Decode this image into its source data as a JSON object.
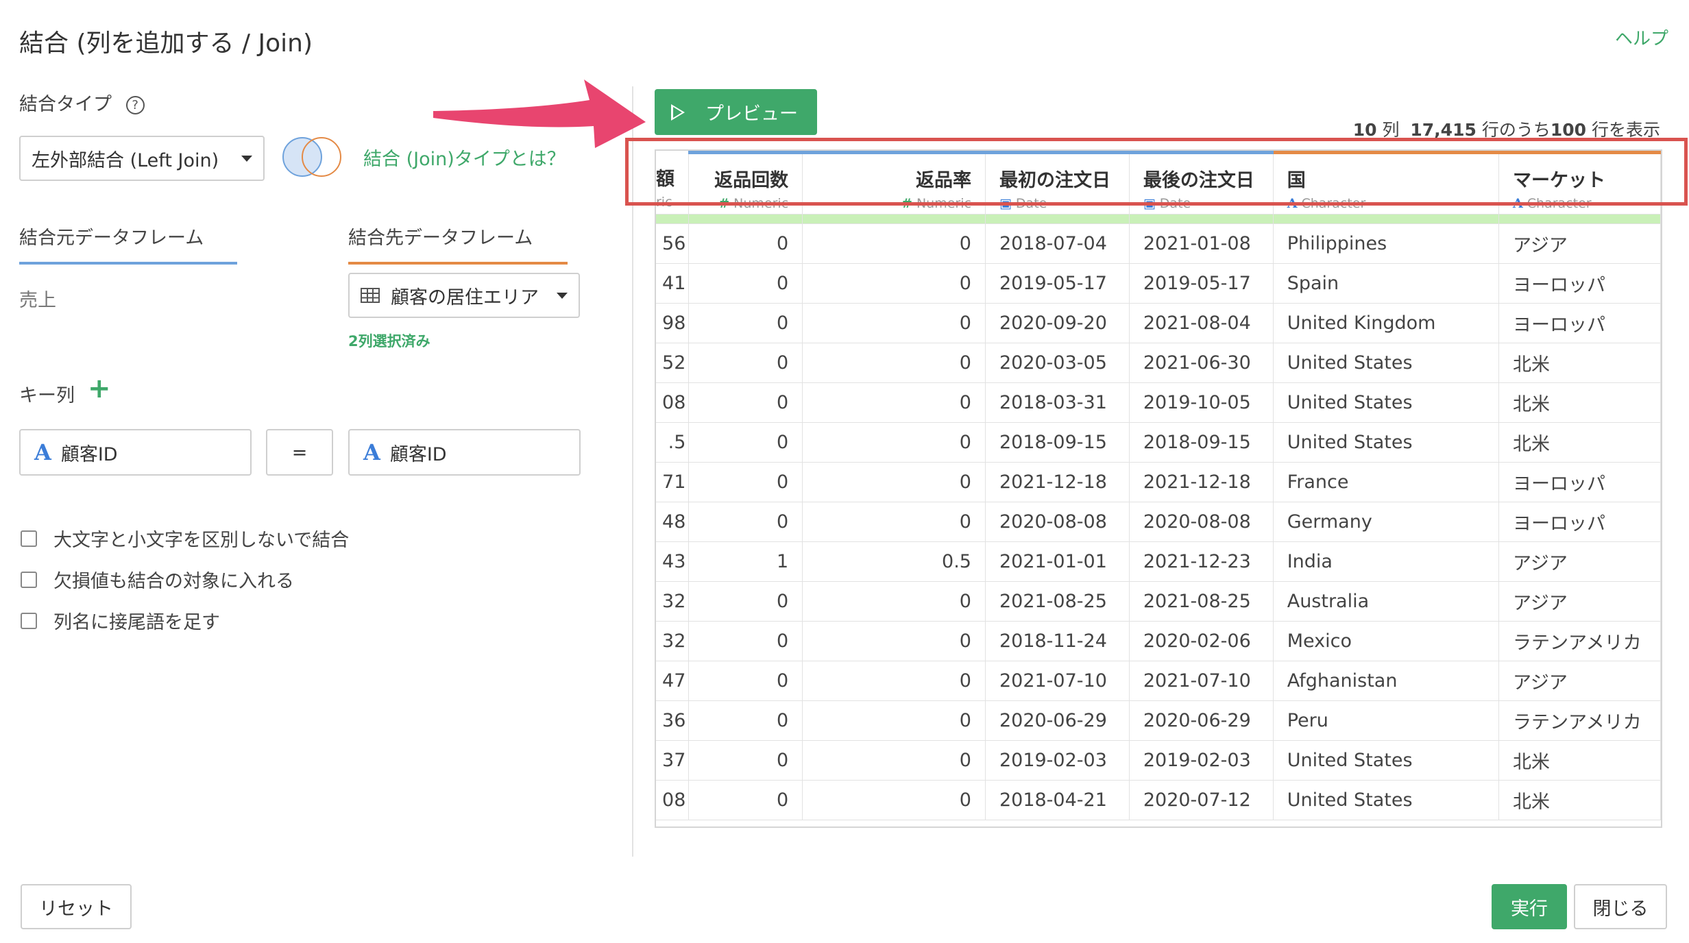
{
  "dialog": {
    "title": "結合 (列を追加する / Join)",
    "help_label": "ヘルプ"
  },
  "join_type": {
    "label": "結合タイプ",
    "help_icon": "question-circle-icon",
    "selected": "左外部結合 (Left Join)",
    "about_link": "結合 (Join)タイプとは？"
  },
  "source_tabs": {
    "left_label": "結合元データフレーム",
    "right_label": "結合先データフレーム",
    "left_value": "売上",
    "right_value": "顧客の居住エリア",
    "right_note": "2列選択済み"
  },
  "key_columns": {
    "label": "キー列",
    "add_icon": "plus-icon",
    "left_type": "A",
    "left_name": "顧客ID",
    "operator": "=",
    "right_type": "A",
    "right_name": "顧客ID"
  },
  "options": [
    {
      "label": "大文字と小文字を区別しないで結合",
      "checked": false
    },
    {
      "label": "欠損値も結合の対象に入れる",
      "checked": false
    },
    {
      "label": "列名に接尾語を足す",
      "checked": false
    }
  ],
  "preview": {
    "button_label": "プレビュー",
    "summary_cols": "10",
    "summary_cols_unit": "列",
    "summary_total": "17,415",
    "summary_mid": "行のうち",
    "summary_shown": "100",
    "summary_end": "行を表示"
  },
  "table": {
    "columns": [
      {
        "name": "額",
        "type": "ric",
        "type_icon": ""
      },
      {
        "name": "返品回数",
        "type": "Numeric",
        "type_icon": "#"
      },
      {
        "name": "返品率",
        "type": "Numeric",
        "type_icon": "#"
      },
      {
        "name": "最初の注文日",
        "type": "Date",
        "type_icon": "calendar-icon"
      },
      {
        "name": "最後の注文日",
        "type": "Date",
        "type_icon": "calendar-icon"
      },
      {
        "name": "国",
        "type": "Character",
        "type_icon": "A"
      },
      {
        "name": "マーケット",
        "type": "Character",
        "type_icon": "A"
      }
    ],
    "rows": [
      [
        "56",
        "0",
        "0",
        "2018-07-04",
        "2021-01-08",
        "Philippines",
        "アジア"
      ],
      [
        "41",
        "0",
        "0",
        "2019-05-17",
        "2019-05-17",
        "Spain",
        "ヨーロッパ"
      ],
      [
        "98",
        "0",
        "0",
        "2020-09-20",
        "2021-08-04",
        "United Kingdom",
        "ヨーロッパ"
      ],
      [
        "52",
        "0",
        "0",
        "2020-03-05",
        "2021-06-30",
        "United States",
        "北米"
      ],
      [
        "08",
        "0",
        "0",
        "2018-03-31",
        "2019-10-05",
        "United States",
        "北米"
      ],
      [
        ".5",
        "0",
        "0",
        "2018-09-15",
        "2018-09-15",
        "United States",
        "北米"
      ],
      [
        "71",
        "0",
        "0",
        "2021-12-18",
        "2021-12-18",
        "France",
        "ヨーロッパ"
      ],
      [
        "48",
        "0",
        "0",
        "2020-08-08",
        "2020-08-08",
        "Germany",
        "ヨーロッパ"
      ],
      [
        "43",
        "1",
        "0.5",
        "2021-01-01",
        "2021-12-23",
        "India",
        "アジア"
      ],
      [
        "32",
        "0",
        "0",
        "2021-08-25",
        "2021-08-25",
        "Australia",
        "アジア"
      ],
      [
        "32",
        "0",
        "0",
        "2018-11-24",
        "2020-02-06",
        "Mexico",
        "ラテンアメリカ"
      ],
      [
        "47",
        "0",
        "0",
        "2021-07-10",
        "2021-07-10",
        "Afghanistan",
        "アジア"
      ],
      [
        "36",
        "0",
        "0",
        "2020-06-29",
        "2020-06-29",
        "Peru",
        "ラテンアメリカ"
      ],
      [
        "37",
        "0",
        "0",
        "2019-02-03",
        "2019-02-03",
        "United States",
        "北米"
      ],
      [
        "08",
        "0",
        "0",
        "2018-04-21",
        "2020-07-12",
        "United States",
        "北米"
      ]
    ]
  },
  "footer": {
    "reset_label": "リセット",
    "run_label": "実行",
    "close_label": "閉じる"
  },
  "colors": {
    "accent_green": "#3fa86a",
    "left_tab": "#6ea2dc",
    "right_tab": "#e48a45",
    "highlight_red": "#d9534f",
    "arrow_pink": "#e8456f"
  }
}
